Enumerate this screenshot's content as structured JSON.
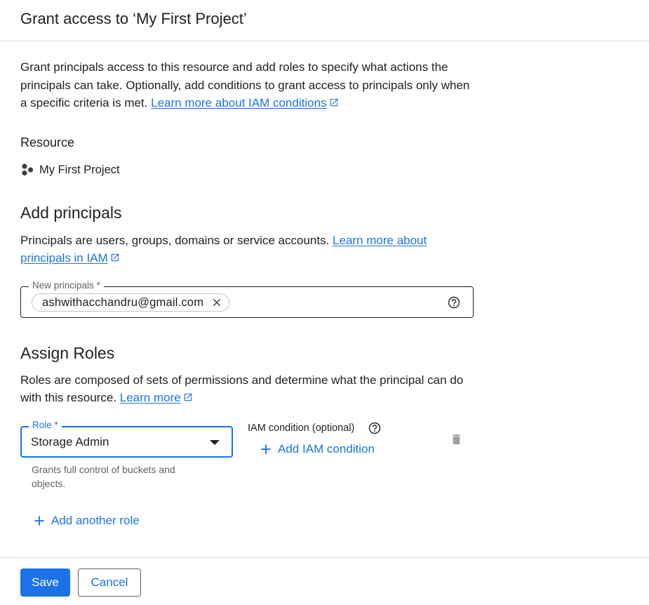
{
  "dialog": {
    "title": "Grant access to ‘My First Project’"
  },
  "intro": {
    "text": "Grant principals access to this resource and add roles to specify what actions the principals can take. Optionally, add conditions to grant access to principals only when a specific criteria is met. ",
    "link": "Learn more about IAM conditions"
  },
  "resource": {
    "heading": "Resource",
    "icon": "project-icon",
    "name": "My First Project"
  },
  "principals": {
    "heading": "Add principals",
    "description": "Principals are users, groups, domains or service accounts. ",
    "link": "Learn more about principals in IAM",
    "field_label": "New principals *",
    "chips": [
      "ashwithacchandru@gmail.com"
    ]
  },
  "roles": {
    "heading": "Assign Roles",
    "description": "Roles are composed of sets of permissions and determine what the principal can do with this resource. ",
    "link": "Learn more",
    "role_label": "Role *",
    "role_value": "Storage Admin",
    "role_hint": "Grants full control of buckets and objects.",
    "iam_condition_label": "IAM condition (optional)",
    "add_condition": "Add IAM condition",
    "add_another_role": "Add another role"
  },
  "footer": {
    "save": "Save",
    "cancel": "Cancel"
  },
  "colors": {
    "accent": "#1a73e8",
    "text": "#202124",
    "muted": "#5f6368",
    "divider": "#dadce0"
  }
}
